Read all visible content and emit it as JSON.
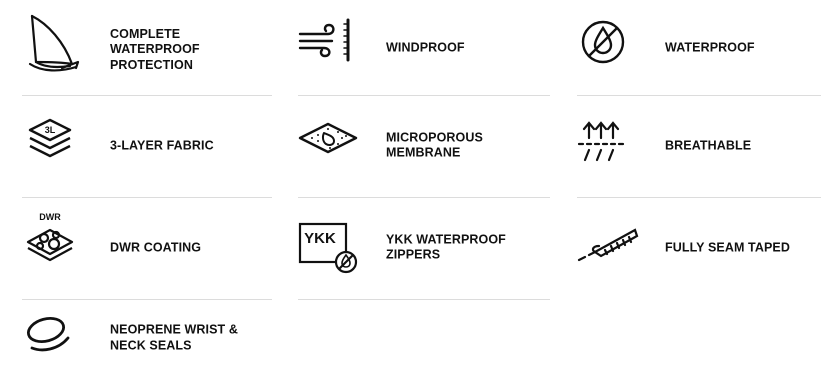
{
  "features": [
    {
      "label": "COMPLETE\nWATERPROOF\nPROTECTION",
      "icon": "sailboat-icon"
    },
    {
      "label": "WINDPROOF",
      "icon": "wind-icon"
    },
    {
      "label": "WATERPROOF",
      "icon": "water-drop-icon"
    },
    {
      "label": "3-LAYER FABRIC",
      "icon": "fabric-layers-icon",
      "icon_text": "3L"
    },
    {
      "label": "MICROPOROUS\nMEMBRANE",
      "icon": "membrane-icon"
    },
    {
      "label": "BREATHABLE",
      "icon": "breathable-icon"
    },
    {
      "label": "DWR COATING",
      "icon": "dwr-coating-icon",
      "icon_text": "DWR"
    },
    {
      "label": "YKK WATERPROOF\nZIPPERS",
      "icon": "ykk-zipper-icon",
      "icon_text": "YKK"
    },
    {
      "label": "FULLY SEAM TAPED",
      "icon": "seam-tape-icon"
    },
    {
      "label": "NEOPRENE WRIST &\nNECK SEALS",
      "icon": "neoprene-seal-icon"
    }
  ]
}
